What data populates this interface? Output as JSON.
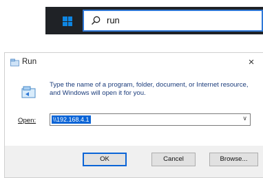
{
  "taskbar": {
    "search_icon": "search-icon",
    "search_text": "run",
    "windows_icon": "windows-start-icon",
    "accent": "#0e86e3"
  },
  "dialog": {
    "title": "Run",
    "close_glyph": "×",
    "description": "Type the name of a program, folder, document, or Internet resource, and Windows will open it for you.",
    "open_label": "Open:",
    "open_value": "\\\\192.168.4.1",
    "buttons": {
      "ok": "OK",
      "cancel": "Cancel",
      "browse": "Browse..."
    },
    "selection_color": "#0a64d6"
  }
}
